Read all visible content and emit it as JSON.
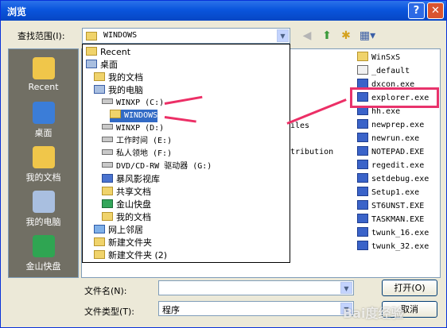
{
  "window": {
    "title": "浏览",
    "help_glyph": "?",
    "close_glyph": "✕"
  },
  "lookin": {
    "label": "查找范围(I):",
    "value": "WINDOWS"
  },
  "places": [
    {
      "label": "Recent",
      "icon": "recent-folder-icon"
    },
    {
      "label": "桌面",
      "icon": "desktop-icon"
    },
    {
      "label": "我的文档",
      "icon": "my-documents-icon"
    },
    {
      "label": "我的电脑",
      "icon": "my-computer-icon"
    },
    {
      "label": "金山快盘",
      "icon": "kuaipan-icon"
    }
  ],
  "dropdown": [
    {
      "label": "Recent",
      "indent": 0,
      "kind": "folder"
    },
    {
      "label": "桌面",
      "indent": 0,
      "kind": "desktop"
    },
    {
      "label": "我的文档",
      "indent": 1,
      "kind": "folder"
    },
    {
      "label": "我的电脑",
      "indent": 1,
      "kind": "pc"
    },
    {
      "label": "WINXP (C:)",
      "indent": 2,
      "kind": "drive"
    },
    {
      "label": "WINDOWS",
      "indent": 3,
      "kind": "folder",
      "selected": true
    },
    {
      "label": "WINXP (D:)",
      "indent": 2,
      "kind": "drive"
    },
    {
      "label": "工作时间 (E:)",
      "indent": 2,
      "kind": "drive"
    },
    {
      "label": "私人领地 (F:)",
      "indent": 2,
      "kind": "drive"
    },
    {
      "label": "DVD/CD-RW 驱动器 (G:)",
      "indent": 2,
      "kind": "drive"
    },
    {
      "label": "暴风影视库",
      "indent": 2,
      "kind": "blue"
    },
    {
      "label": "共享文档",
      "indent": 2,
      "kind": "folder"
    },
    {
      "label": "金山快盘",
      "indent": 2,
      "kind": "green"
    },
    {
      "label": "我的文档",
      "indent": 2,
      "kind": "folder"
    },
    {
      "label": "网上邻居",
      "indent": 1,
      "kind": "net"
    },
    {
      "label": "新建文件夹",
      "indent": 1,
      "kind": "folder"
    },
    {
      "label": "新建文件夹 (2)",
      "indent": 1,
      "kind": "folder"
    }
  ],
  "background_fragments": [
    "iles",
    "tribution"
  ],
  "files": [
    {
      "name": "WinSxS",
      "kind": "dir"
    },
    {
      "name": "_default",
      "kind": "file"
    },
    {
      "name": "dxcon.exe",
      "kind": "exe"
    },
    {
      "name": "explorer.exe",
      "kind": "exe"
    },
    {
      "name": "hh.exe",
      "kind": "exe"
    },
    {
      "name": "newprep.exe",
      "kind": "exe"
    },
    {
      "name": "newrun.exe",
      "kind": "exe"
    },
    {
      "name": "NOTEPAD.EXE",
      "kind": "exe"
    },
    {
      "name": "regedit.exe",
      "kind": "exe"
    },
    {
      "name": "setdebug.exe",
      "kind": "exe"
    },
    {
      "name": "Setup1.exe",
      "kind": "exe"
    },
    {
      "name": "ST6UNST.EXE",
      "kind": "exe"
    },
    {
      "name": "TASKMAN.EXE",
      "kind": "exe"
    },
    {
      "name": "twunk_16.exe",
      "kind": "exe"
    },
    {
      "name": "twunk_32.exe",
      "kind": "exe"
    }
  ],
  "filename": {
    "label": "文件名(N):",
    "value": ""
  },
  "filetype": {
    "label": "文件类型(T):",
    "value": "程序"
  },
  "buttons": {
    "open": "打开(O)",
    "cancel": "取消"
  },
  "watermark": "Bai度经验",
  "colors": {
    "highlight": "#e8336c",
    "title_bar": "#0a55dc",
    "selection": "#316ac5"
  }
}
